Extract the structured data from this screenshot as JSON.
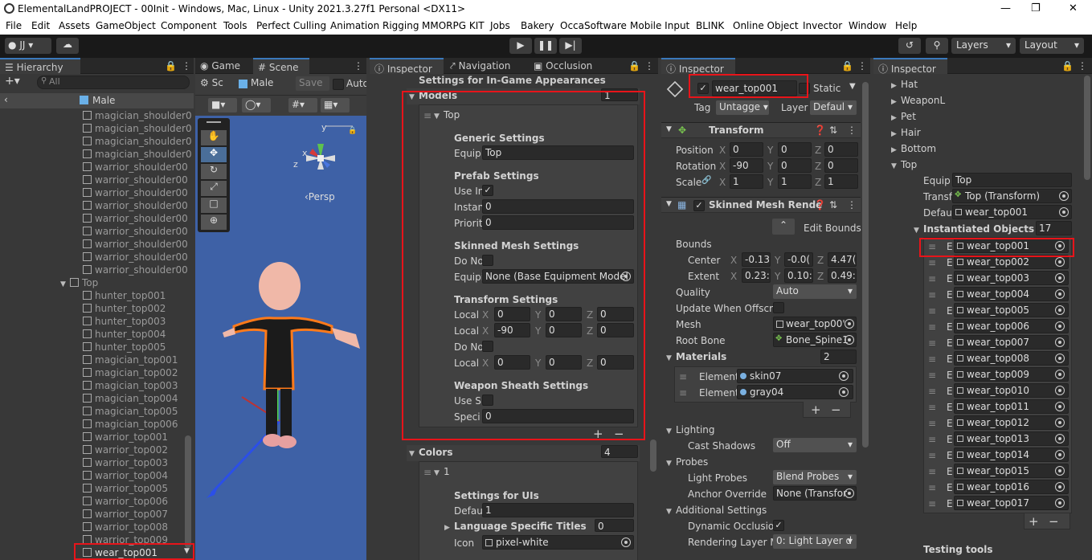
{
  "window": {
    "title": "ElementalLandPROJECT - 00Init - Windows, Mac, Linux - Unity 2021.3.27f1 Personal <DX11>"
  },
  "menu": [
    "File",
    "Edit",
    "Assets",
    "GameObject",
    "Component",
    "Tools",
    "Perfect Culling",
    "Animation Rigging",
    "MMORPG KIT",
    "Jobs",
    "Bakery",
    "OccaSoftware",
    "Mobile Input",
    "BLINK",
    "Online Object",
    "Invector",
    "Window",
    "Help"
  ],
  "toolbar": {
    "account": "JJ",
    "layers": "Layers",
    "layout": "Layout"
  },
  "hierarchy": {
    "tab": "Hierarchy",
    "search_placeholder": "All",
    "root": "Male",
    "items": [
      "magician_shoulder0",
      "magician_shoulder0",
      "magician_shoulder0",
      "magician_shoulder0",
      "warrior_shoulder00",
      "warrior_shoulder00",
      "warrior_shoulder00",
      "warrior_shoulder00",
      "warrior_shoulder00",
      "warrior_shoulder00",
      "warrior_shoulder00",
      "warrior_shoulder00",
      "warrior_shoulder00"
    ],
    "group": "Top",
    "children": [
      "hunter_top001",
      "hunter_top002",
      "hunter_top003",
      "hunter_top004",
      "hunter_top005",
      "magician_top001",
      "magician_top002",
      "magician_top003",
      "magician_top004",
      "magician_top005",
      "magician_top006",
      "warrior_top001",
      "warrior_top002",
      "warrior_top003",
      "warrior_top004",
      "warrior_top005",
      "warrior_top006",
      "warrior_top007",
      "warrior_top008",
      "warrior_top009",
      "wear_top001"
    ]
  },
  "scene": {
    "tabs": [
      "Game",
      "Scene"
    ],
    "toolbar_tab": "Sc",
    "object": "Male",
    "save": "Save",
    "auto": "Auto",
    "persp": "‹Persp",
    "axis_y": "y",
    "axis_x": "x",
    "axis_z": "z"
  },
  "inspector1": {
    "tabs": [
      "Inspector",
      "Navigation",
      "Occlusion"
    ],
    "heading": "Settings for In-Game Appearances",
    "models_label": "Models",
    "models_count": "1",
    "top_label": "Top",
    "generic_settings": "Generic Settings",
    "equip_label": "Equip",
    "equip_value": "Top",
    "prefab_settings": "Prefab Settings",
    "use_in_label": "Use In",
    "instan_label": "Instan",
    "instan_value": "0",
    "priorit_label": "Priorit",
    "priorit_value": "0",
    "skinned_mesh_settings": "Skinned Mesh Settings",
    "do_no_label": "Do No",
    "equipi_label": "Equipi",
    "equipi_value": "None (Base Equipment Model",
    "transform_settings": "Transform Settings",
    "local_label": "Local",
    "local1": {
      "x": "0",
      "y": "0",
      "z": "0"
    },
    "local2": {
      "x": "-90",
      "y": "0",
      "z": "0"
    },
    "do_no2_label": "Do No",
    "local3_label": "Local",
    "local3": {
      "x": "0",
      "y": "0",
      "z": "0"
    },
    "weapon_sheath_settings": "Weapon Sheath Settings",
    "use_s_label": "Use S",
    "speci_label": "Speci",
    "speci_value": "0",
    "colors_label": "Colors",
    "colors_count": "4",
    "colors_item": "1",
    "settings_for_uis": "Settings for UIs",
    "defau_label": "Defau",
    "defau_value": "1",
    "lang_titles": "Language Specific Titles",
    "lang_count": "0",
    "icon_label": "Icon",
    "icon_value": "pixel-white"
  },
  "inspector2": {
    "tab": "Inspector",
    "object_name": "wear_top001",
    "static": "Static",
    "tag_label": "Tag",
    "tag_value": "Untagge",
    "layer_label": "Layer",
    "layer_value": "Defaul",
    "transform": "Transform",
    "position_label": "Position",
    "position": {
      "x": "0",
      "y": "0",
      "z": "0"
    },
    "rotation_label": "Rotation",
    "rotation": {
      "x": "-90",
      "y": "0",
      "z": "0"
    },
    "scale_label": "Scale",
    "scale": {
      "x": "1",
      "y": "1",
      "z": "1"
    },
    "smr": "Skinned Mesh Rende",
    "edit_bounds": "Edit Bounds",
    "bounds": "Bounds",
    "center_label": "Center",
    "center": {
      "x": "-0.13",
      "y": "-0.0(",
      "z": "4.47("
    },
    "extent_label": "Extent",
    "extent": {
      "x": "0.23:",
      "y": "0.10:",
      "z": "0.49:"
    },
    "quality_label": "Quality",
    "quality_value": "Auto",
    "update_offscreen": "Update When Offscre",
    "mesh_label": "Mesh",
    "mesh_value": "wear_top00'",
    "root_bone_label": "Root Bone",
    "root_bone_value": "Bone_Spine1",
    "materials": "Materials",
    "materials_count": "2",
    "element_label": "Element",
    "mat1": "skin07",
    "mat2": "gray04",
    "lighting": "Lighting",
    "cast_shadows_label": "Cast Shadows",
    "cast_shadows_value": "Off",
    "probes": "Probes",
    "light_probes_label": "Light Probes",
    "light_probes_value": "Blend Probes",
    "anchor_label": "Anchor Override",
    "anchor_value": "None (Transfor",
    "additional": "Additional Settings",
    "dynamic_occ": "Dynamic Occlusio",
    "rendering_layer_label": "Rendering Layer M",
    "rendering_layer_value": "0: Light Layer d"
  },
  "inspector3": {
    "tab": "Inspector",
    "groups": [
      "Hat",
      "WeaponL",
      "Pet",
      "Hair",
      "Bottom",
      "Top"
    ],
    "equip_label": "Equip S",
    "equip_value": "Top",
    "transf_label": "Transf",
    "transf_value": "Top (Transform)",
    "defaul_label": "Defaul",
    "defaul_value": "wear_top001",
    "inst_label": "Instantiated Objects",
    "inst_count": "17",
    "element_prefix": "E",
    "objects": [
      "wear_top001",
      "wear_top002",
      "wear_top003",
      "wear_top004",
      "wear_top005",
      "wear_top006",
      "wear_top007",
      "wear_top008",
      "wear_top009",
      "wear_top010",
      "wear_top011",
      "wear_top012",
      "wear_top013",
      "wear_top014",
      "wear_top015",
      "wear_top016",
      "wear_top017"
    ],
    "testing_tools": "Testing tools"
  },
  "colors": {
    "highlight": "#e8141a",
    "accent": "#3a79bb",
    "bg": "#383838",
    "scene_bg": "#3e61a6"
  }
}
